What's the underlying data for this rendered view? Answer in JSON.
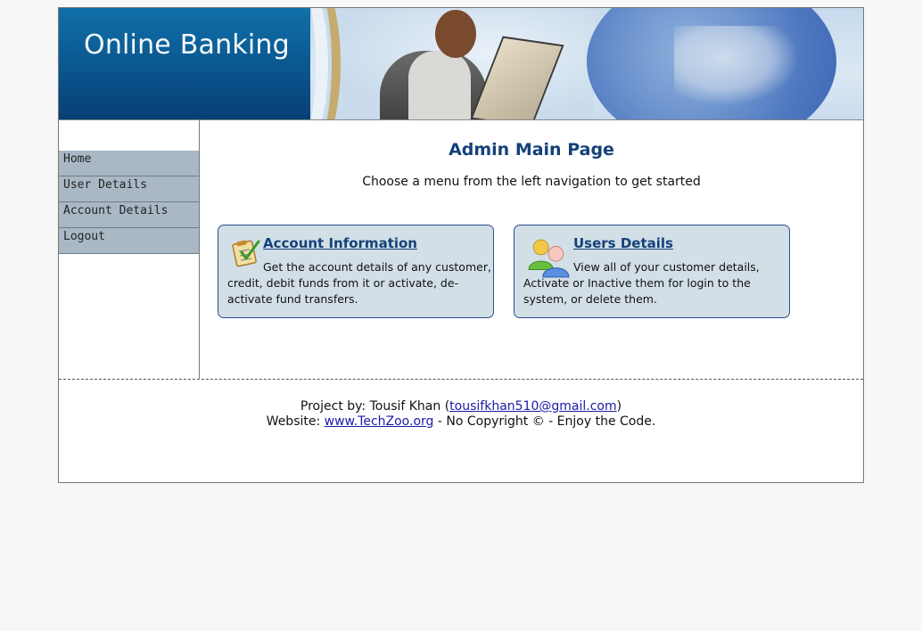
{
  "banner": {
    "title": "Online Banking"
  },
  "sidebar": {
    "items": [
      {
        "label": "Home"
      },
      {
        "label": "User Details"
      },
      {
        "label": "Account Details"
      },
      {
        "label": "Logout"
      }
    ]
  },
  "main": {
    "title": "Admin Main Page",
    "subtitle": "Choose a menu from the left navigation to get started",
    "cards": [
      {
        "title": "Account Information",
        "text": "Get the account details of any customer, credit, debit funds from it or activate, de-activate fund transfers.",
        "icon": "checklist-icon"
      },
      {
        "title": "Users Details",
        "text": "View all of your customer details, Activate or Inactive them for login to the system, or delete them.",
        "icon": "users-icon"
      }
    ]
  },
  "footer": {
    "project_prefix": "Project by: Tousif Khan (",
    "email": "tousifkhan510@gmail.com",
    "project_suffix": ")",
    "website_prefix": "Website: ",
    "website": "www.TechZoo.org",
    "website_suffix": " - No Copyright © - Enjoy the Code."
  },
  "colors": {
    "page_background": "#f7f7f7",
    "nav_background": "#aab8c6",
    "card_background": "#d2dfe6",
    "heading": "#14417a",
    "link": "#1a1aa8"
  }
}
